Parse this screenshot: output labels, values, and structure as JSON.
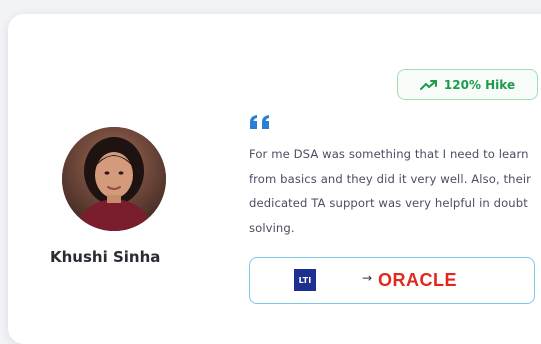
{
  "card": {
    "badge": {
      "icon": "trending-up-icon",
      "label": "120% Hike",
      "color": "#1f9a4d"
    },
    "person": {
      "name": "Khushi Sinha"
    },
    "testimonial": {
      "quote_icon": "quote-icon",
      "text": "For me DSA was something that I need to learn from basics and they did it very well. Also, their dedicated TA support was very helpful in doubt solving."
    },
    "transition": {
      "from_company": "LTI",
      "arrow": "→",
      "to_company": "ORACLE",
      "from_color": "#1d2f8f",
      "to_color": "#e0281f"
    }
  }
}
